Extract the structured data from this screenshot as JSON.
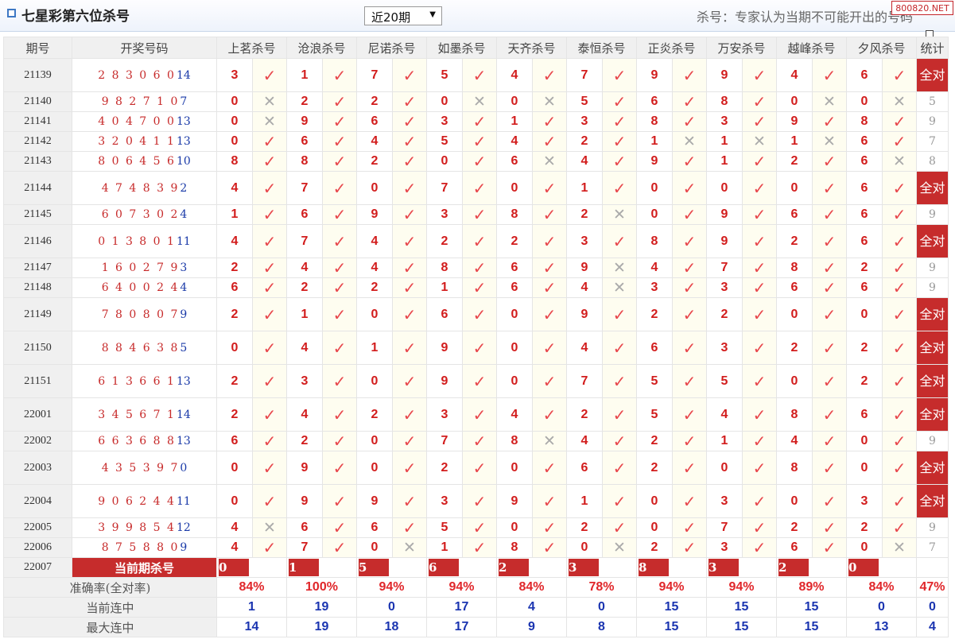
{
  "header": {
    "title": "七星彩第六位杀号",
    "period_select": "近20期",
    "note": "杀号：专家认为当期不可能开出的号码",
    "watermark": "800820.NET"
  },
  "columns": {
    "issue": "期号",
    "draw": "开奖号码",
    "experts": [
      "上茗杀号",
      "沧浪杀号",
      "尼诺杀号",
      "如墨杀号",
      "天齐杀号",
      "泰恒杀号",
      "正炎杀号",
      "万安杀号",
      "越峰杀号",
      "夕风杀号"
    ],
    "stat": "统计"
  },
  "rows": [
    {
      "issue": "21139",
      "digits": "2 8 3 0 6 0",
      "last": "14",
      "kills": [
        "3",
        "1",
        "7",
        "5",
        "4",
        "7",
        "9",
        "9",
        "4",
        "6"
      ],
      "hits": [
        1,
        1,
        1,
        1,
        1,
        1,
        1,
        1,
        1,
        1
      ],
      "stat": "全对",
      "tall": true
    },
    {
      "issue": "21140",
      "digits": "9 8 2 7 1 0",
      "last": "7",
      "kills": [
        "0",
        "2",
        "2",
        "0",
        "0",
        "5",
        "6",
        "8",
        "0",
        "0"
      ],
      "hits": [
        0,
        1,
        1,
        0,
        0,
        1,
        1,
        1,
        0,
        0
      ],
      "stat": "5",
      "tall": false
    },
    {
      "issue": "21141",
      "digits": "4 0 4 7 0 0",
      "last": "13",
      "kills": [
        "0",
        "9",
        "6",
        "3",
        "1",
        "3",
        "8",
        "3",
        "9",
        "8"
      ],
      "hits": [
        0,
        1,
        1,
        1,
        1,
        1,
        1,
        1,
        1,
        1
      ],
      "stat": "9",
      "tall": false
    },
    {
      "issue": "21142",
      "digits": "3 2 0 4 1 1",
      "last": "13",
      "kills": [
        "0",
        "6",
        "4",
        "5",
        "4",
        "2",
        "1",
        "1",
        "1",
        "6"
      ],
      "hits": [
        1,
        1,
        1,
        1,
        1,
        1,
        0,
        0,
        0,
        1
      ],
      "stat": "7",
      "tall": false
    },
    {
      "issue": "21143",
      "digits": "8 0 6 4 5 6",
      "last": "10",
      "kills": [
        "8",
        "8",
        "2",
        "0",
        "6",
        "4",
        "9",
        "1",
        "2",
        "6"
      ],
      "hits": [
        1,
        1,
        1,
        1,
        0,
        1,
        1,
        1,
        1,
        0
      ],
      "stat": "8",
      "tall": false
    },
    {
      "issue": "21144",
      "digits": "4 7 4 8 3 9",
      "last": "2",
      "kills": [
        "4",
        "7",
        "0",
        "7",
        "0",
        "1",
        "0",
        "0",
        "0",
        "6"
      ],
      "hits": [
        1,
        1,
        1,
        1,
        1,
        1,
        1,
        1,
        1,
        1
      ],
      "stat": "全对",
      "tall": true
    },
    {
      "issue": "21145",
      "digits": "6 0 7 3 0 2",
      "last": "4",
      "kills": [
        "1",
        "6",
        "9",
        "3",
        "8",
        "2",
        "0",
        "9",
        "6",
        "6"
      ],
      "hits": [
        1,
        1,
        1,
        1,
        1,
        0,
        1,
        1,
        1,
        1
      ],
      "stat": "9",
      "tall": false
    },
    {
      "issue": "21146",
      "digits": "0 1 3 8 0 1",
      "last": "11",
      "kills": [
        "4",
        "7",
        "4",
        "2",
        "2",
        "3",
        "8",
        "9",
        "2",
        "6"
      ],
      "hits": [
        1,
        1,
        1,
        1,
        1,
        1,
        1,
        1,
        1,
        1
      ],
      "stat": "全对",
      "tall": true
    },
    {
      "issue": "21147",
      "digits": "1 6 0 2 7 9",
      "last": "3",
      "kills": [
        "2",
        "4",
        "4",
        "8",
        "6",
        "9",
        "4",
        "7",
        "8",
        "2"
      ],
      "hits": [
        1,
        1,
        1,
        1,
        1,
        0,
        1,
        1,
        1,
        1
      ],
      "stat": "9",
      "tall": false
    },
    {
      "issue": "21148",
      "digits": "6 4 0 0 2 4",
      "last": "4",
      "kills": [
        "6",
        "2",
        "2",
        "1",
        "6",
        "4",
        "3",
        "3",
        "6",
        "6"
      ],
      "hits": [
        1,
        1,
        1,
        1,
        1,
        0,
        1,
        1,
        1,
        1
      ],
      "stat": "9",
      "tall": false
    },
    {
      "issue": "21149",
      "digits": "7 8 0 8 0 7",
      "last": "9",
      "kills": [
        "2",
        "1",
        "0",
        "6",
        "0",
        "9",
        "2",
        "2",
        "0",
        "0"
      ],
      "hits": [
        1,
        1,
        1,
        1,
        1,
        1,
        1,
        1,
        1,
        1
      ],
      "stat": "全对",
      "tall": true
    },
    {
      "issue": "21150",
      "digits": "8 8 4 6 3 8",
      "last": "5",
      "kills": [
        "0",
        "4",
        "1",
        "9",
        "0",
        "4",
        "6",
        "3",
        "2",
        "2"
      ],
      "hits": [
        1,
        1,
        1,
        1,
        1,
        1,
        1,
        1,
        1,
        1
      ],
      "stat": "全对",
      "tall": true
    },
    {
      "issue": "21151",
      "digits": "6 1 3 6 6 1",
      "last": "13",
      "kills": [
        "2",
        "3",
        "0",
        "9",
        "0",
        "7",
        "5",
        "5",
        "0",
        "2"
      ],
      "hits": [
        1,
        1,
        1,
        1,
        1,
        1,
        1,
        1,
        1,
        1
      ],
      "stat": "全对",
      "tall": true
    },
    {
      "issue": "22001",
      "digits": "3 4 5 6 7 1",
      "last": "14",
      "kills": [
        "2",
        "4",
        "2",
        "3",
        "4",
        "2",
        "5",
        "4",
        "8",
        "6"
      ],
      "hits": [
        1,
        1,
        1,
        1,
        1,
        1,
        1,
        1,
        1,
        1
      ],
      "stat": "全对",
      "tall": true
    },
    {
      "issue": "22002",
      "digits": "6 6 3 6 8 8",
      "last": "13",
      "kills": [
        "6",
        "2",
        "0",
        "7",
        "8",
        "4",
        "2",
        "1",
        "4",
        "0"
      ],
      "hits": [
        1,
        1,
        1,
        1,
        0,
        1,
        1,
        1,
        1,
        1
      ],
      "stat": "9",
      "tall": false
    },
    {
      "issue": "22003",
      "digits": "4 3 5 3 9 7",
      "last": "0",
      "kills": [
        "0",
        "9",
        "0",
        "2",
        "0",
        "6",
        "2",
        "0",
        "8",
        "0"
      ],
      "hits": [
        1,
        1,
        1,
        1,
        1,
        1,
        1,
        1,
        1,
        1
      ],
      "stat": "全对",
      "tall": true
    },
    {
      "issue": "22004",
      "digits": "9 0 6 2 4 4",
      "last": "11",
      "kills": [
        "0",
        "9",
        "9",
        "3",
        "9",
        "1",
        "0",
        "3",
        "0",
        "3"
      ],
      "hits": [
        1,
        1,
        1,
        1,
        1,
        1,
        1,
        1,
        1,
        1
      ],
      "stat": "全对",
      "tall": true
    },
    {
      "issue": "22005",
      "digits": "3 9 9 8 5 4",
      "last": "12",
      "kills": [
        "4",
        "6",
        "6",
        "5",
        "0",
        "2",
        "0",
        "7",
        "2",
        "2"
      ],
      "hits": [
        0,
        1,
        1,
        1,
        1,
        1,
        1,
        1,
        1,
        1
      ],
      "stat": "9",
      "tall": false
    },
    {
      "issue": "22006",
      "digits": "8 7 5 8 8 0",
      "last": "9",
      "kills": [
        "4",
        "7",
        "0",
        "1",
        "8",
        "0",
        "2",
        "3",
        "6",
        "0"
      ],
      "hits": [
        1,
        1,
        0,
        1,
        1,
        0,
        1,
        1,
        1,
        0
      ],
      "stat": "7",
      "tall": false
    }
  ],
  "current": {
    "issue": "22007",
    "label": "当前期杀号",
    "kills": [
      "0",
      "1",
      "5",
      "6",
      "2",
      "3",
      "8",
      "3",
      "2",
      "0"
    ]
  },
  "stats": {
    "rate_label": "准确率(全对率)",
    "rates": [
      "84%",
      "100%",
      "94%",
      "94%",
      "84%",
      "78%",
      "94%",
      "94%",
      "89%",
      "84%"
    ],
    "rate_total": "47%",
    "cur_label": "当前连中",
    "cur_streak": [
      "1",
      "19",
      "0",
      "17",
      "4",
      "0",
      "15",
      "15",
      "15",
      "0"
    ],
    "cur_total": "0",
    "max_label": "最大连中",
    "max_streak": [
      "14",
      "19",
      "18",
      "17",
      "9",
      "8",
      "15",
      "15",
      "15",
      "13"
    ],
    "max_total": "4"
  },
  "marks": {
    "hit": "✓",
    "miss": "✕"
  },
  "colors": {
    "accent": "#c62c2c",
    "hit": "#e8474c",
    "miss": "#aaaaaa",
    "streak": "#1a34b0"
  }
}
